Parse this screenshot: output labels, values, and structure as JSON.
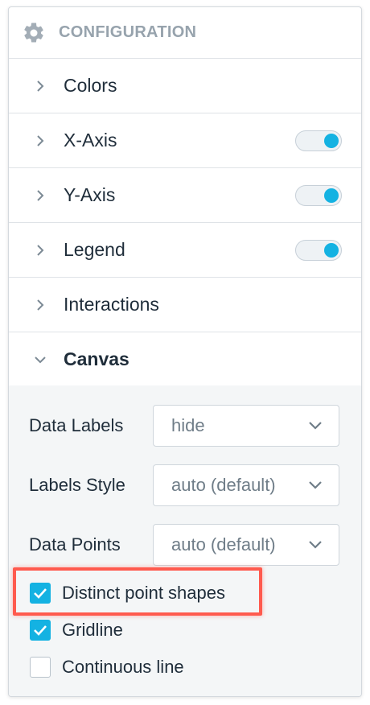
{
  "header": {
    "title": "CONFIGURATION",
    "icon": "gear-icon"
  },
  "sections": [
    {
      "label": "Colors",
      "toggle": null
    },
    {
      "label": "X-Axis",
      "toggle": true
    },
    {
      "label": "Y-Axis",
      "toggle": true
    },
    {
      "label": "Legend",
      "toggle": true
    },
    {
      "label": "Interactions",
      "toggle": null
    },
    {
      "label": "Canvas",
      "expanded": true
    }
  ],
  "canvas": {
    "data_labels": {
      "label": "Data Labels",
      "value": "hide"
    },
    "labels_style": {
      "label": "Labels Style",
      "value": "auto (default)"
    },
    "data_points": {
      "label": "Data Points",
      "value": "auto (default)"
    },
    "checkboxes": [
      {
        "label": "Distinct point shapes",
        "checked": true
      },
      {
        "label": "Gridline",
        "checked": true
      },
      {
        "label": "Continuous line",
        "checked": false
      }
    ]
  },
  "colors": {
    "accent": "#14b2e2",
    "highlight": "#ff5a4e",
    "muted": "#97a3ad"
  }
}
